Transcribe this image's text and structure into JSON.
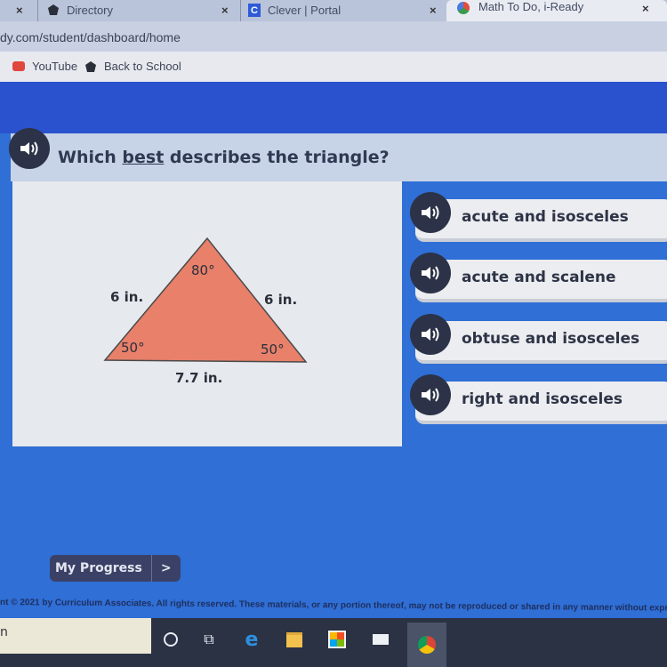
{
  "browser": {
    "tabs": [
      {
        "label": "",
        "close": "×"
      },
      {
        "label": "Directory",
        "close": "×"
      },
      {
        "label": "Clever | Portal",
        "close": "×"
      },
      {
        "label": "Math To Do, i-Ready",
        "close": "×",
        "active": true
      }
    ],
    "address": "dy.com/student/dashboard/home",
    "bookmarks": [
      {
        "label": "YouTube",
        "icon": "youtube-icon"
      },
      {
        "label": "Back to School",
        "icon": "school-icon"
      }
    ]
  },
  "question": {
    "prefix": "Which ",
    "emphasis": "best",
    "suffix": " describes the triangle?"
  },
  "triangle": {
    "left_side": "6 in.",
    "right_side": "6 in.",
    "base": "7.7 in.",
    "top_angle": "80°",
    "left_angle": "50°",
    "right_angle": "50°",
    "fill_color": "#e8806a"
  },
  "answers": [
    {
      "label": "acute and isosceles"
    },
    {
      "label": "acute and scalene"
    },
    {
      "label": "obtuse and isosceles"
    },
    {
      "label": "right and isosceles"
    }
  ],
  "footer": {
    "progress_label": "My Progress",
    "progress_arrow": ">",
    "copyright": "nt © 2021 by Curriculum Associates. All rights reserved. These materials, or any portion thereof, may not be reproduced or shared in any manner without express"
  },
  "taskbar": {
    "search_text": "n",
    "icons": [
      "cortana-icon",
      "task-view-icon",
      "edge-icon",
      "file-explorer-icon",
      "store-icon",
      "mail-icon",
      "chrome-icon"
    ]
  }
}
